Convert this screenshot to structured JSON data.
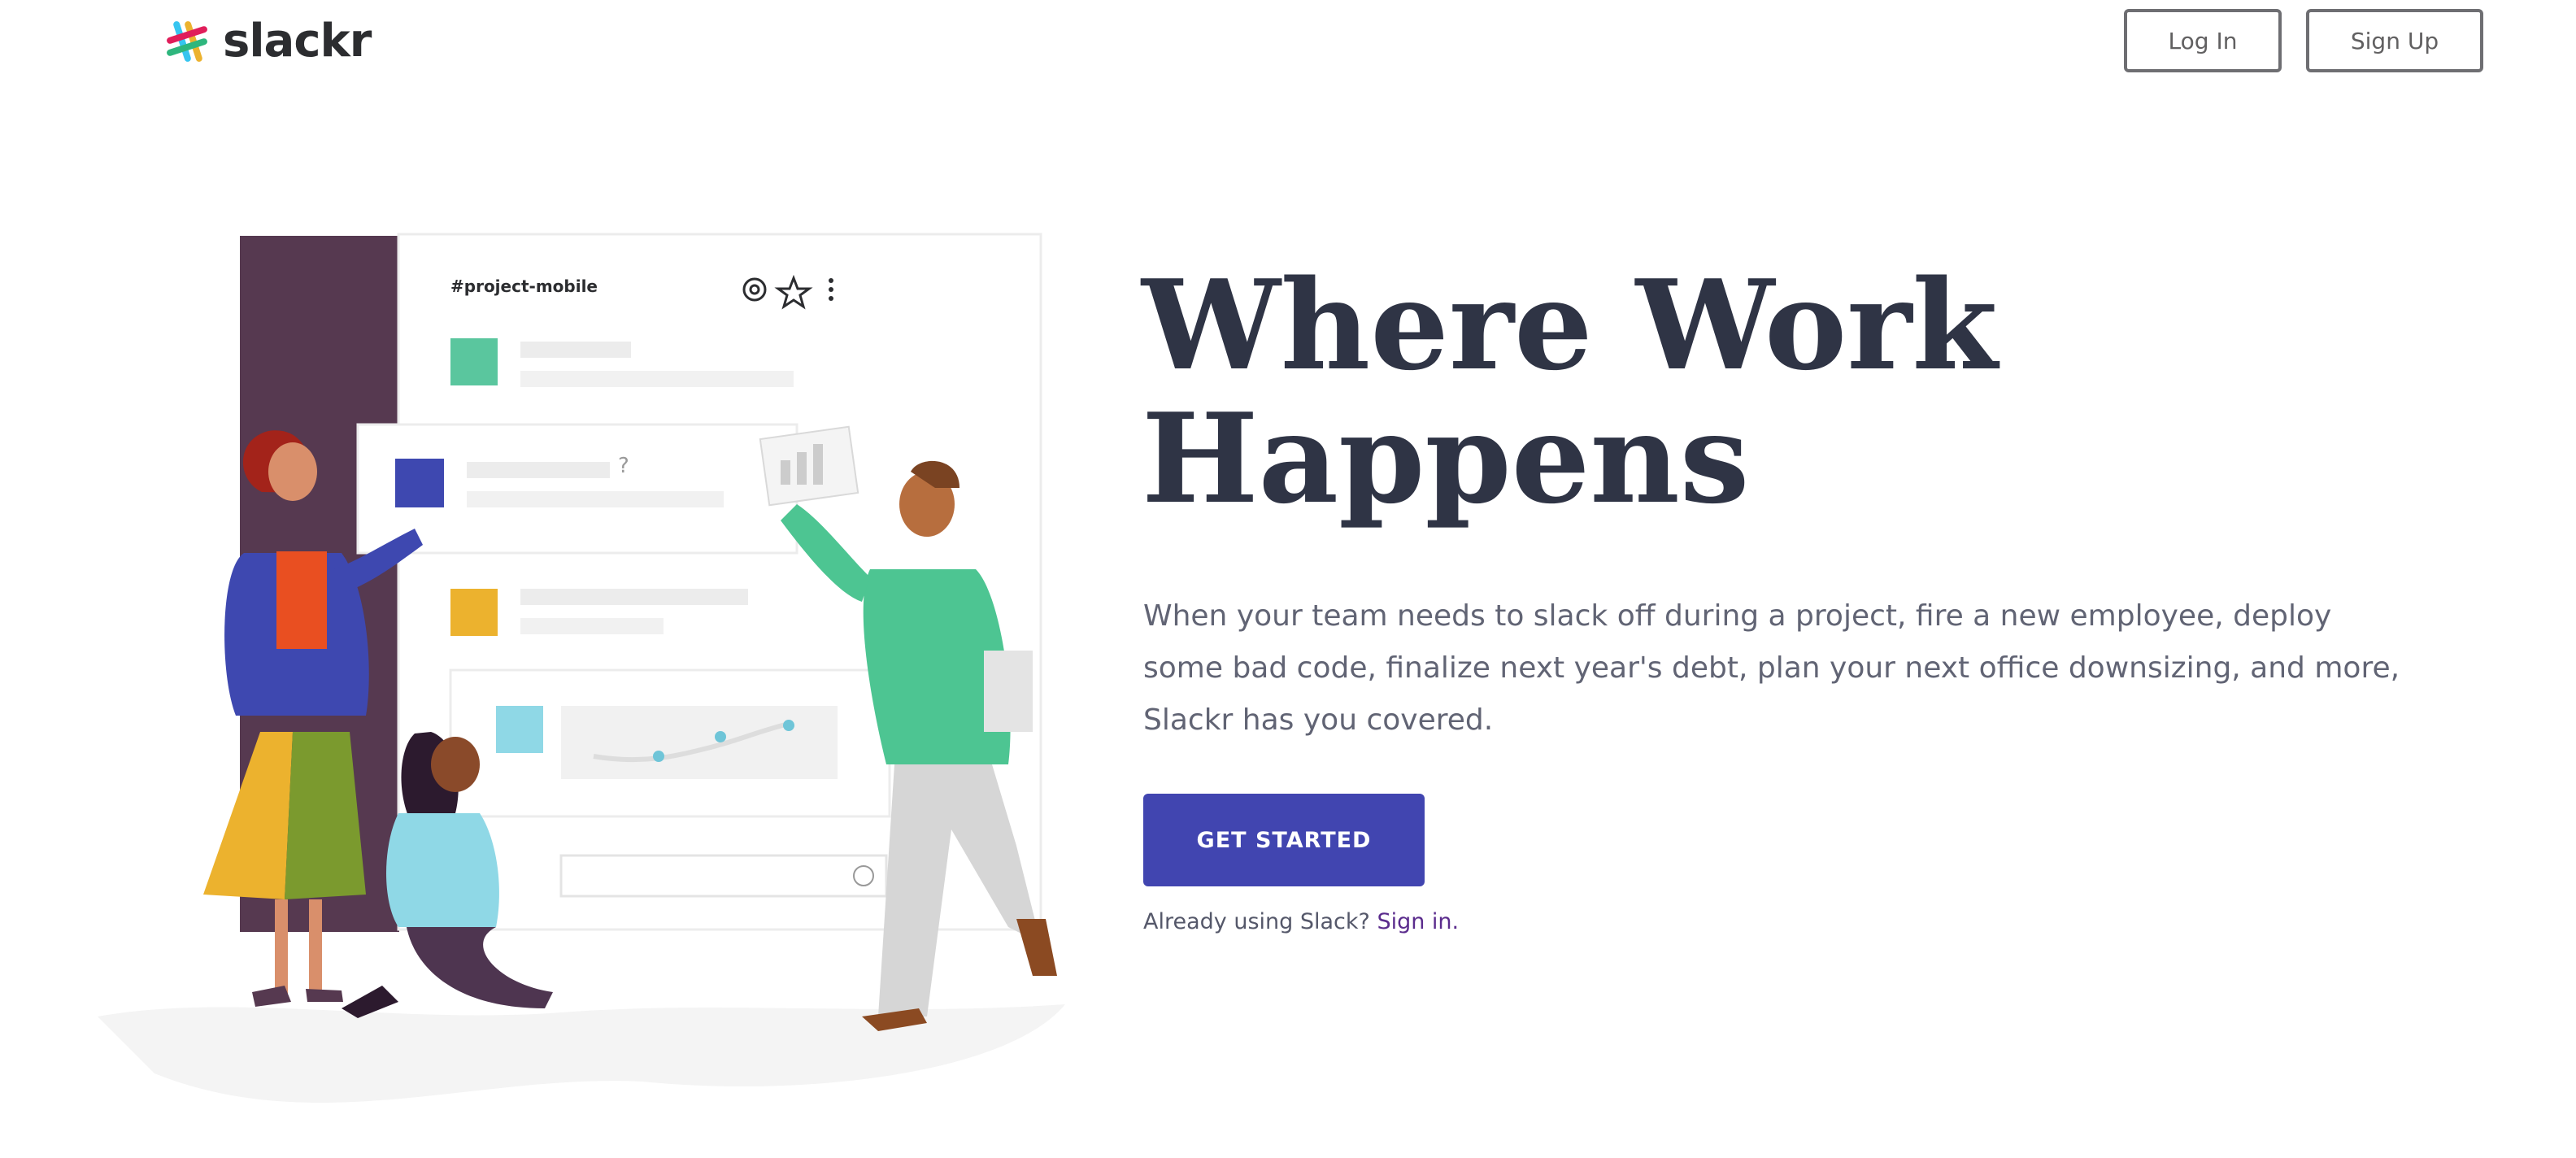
{
  "header": {
    "brand": "slackr",
    "login_label": "Log In",
    "signup_label": "Sign Up"
  },
  "hero": {
    "title_line1": "Where Work",
    "title_line2": "Happens",
    "description": "When your team needs to slack off during a project, fire a new employee, deploy some bad code, finalize next year's debt, plan your next office downsizing, and more, Slackr has you covered.",
    "cta_label": "GET STARTED",
    "already_text": "Already using Slack?",
    "signin_link": "Sign in."
  },
  "illustration": {
    "channel": "#project-mobile",
    "question_mark": "?"
  },
  "colors": {
    "brand_dark": "#2f3445",
    "accent": "#4145b0",
    "link": "#5b2c8d",
    "aubergine": "#563950",
    "green": "#5ac69e",
    "yellow": "#ecb22e",
    "blue": "#3e48b0"
  }
}
